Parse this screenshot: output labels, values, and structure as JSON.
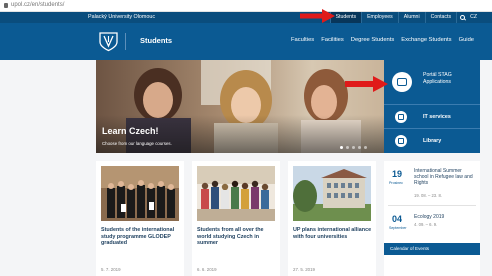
{
  "browser": {
    "url": "upol.cz/en/students/"
  },
  "topbar": {
    "university": "Palacký University Olomouc",
    "links": [
      "Students",
      "Employees",
      "Alumni",
      "Contacts"
    ],
    "active": "Students",
    "language": "CZ"
  },
  "header": {
    "brand": "Students",
    "nav": [
      "Faculties",
      "Facilities",
      "Degree Students",
      "Exchange Students",
      "Guide"
    ]
  },
  "hero": {
    "title": "Learn Czech!",
    "subtitle": "Choose from our language courses."
  },
  "side": {
    "portal": "Portál STAG Applications",
    "items": [
      "IT services",
      "Library"
    ]
  },
  "news": [
    {
      "title": "Students of the international study programme GLODEP graduated",
      "date": "5. 7. 2019"
    },
    {
      "title": "Students from all over the world studying Czech in summer",
      "date": "6. 6. 2019"
    },
    {
      "title": "UP plans international alliance with four universities",
      "date": "27. 5. 2019"
    }
  ],
  "events": [
    {
      "day": "19",
      "month": "Prosinec",
      "title": "International Summer school in Refugee law and Rights",
      "date": "19. 08. – 23. 8."
    },
    {
      "day": "04",
      "month": "September",
      "title": "Ecology 2019",
      "date": "4. 09. – 6. 9."
    }
  ],
  "calendar_label": "Calendar of Events",
  "colors": {
    "brand": "#0b5a93",
    "topbar": "#0a4d7d",
    "arrow": "#e01a1a"
  }
}
